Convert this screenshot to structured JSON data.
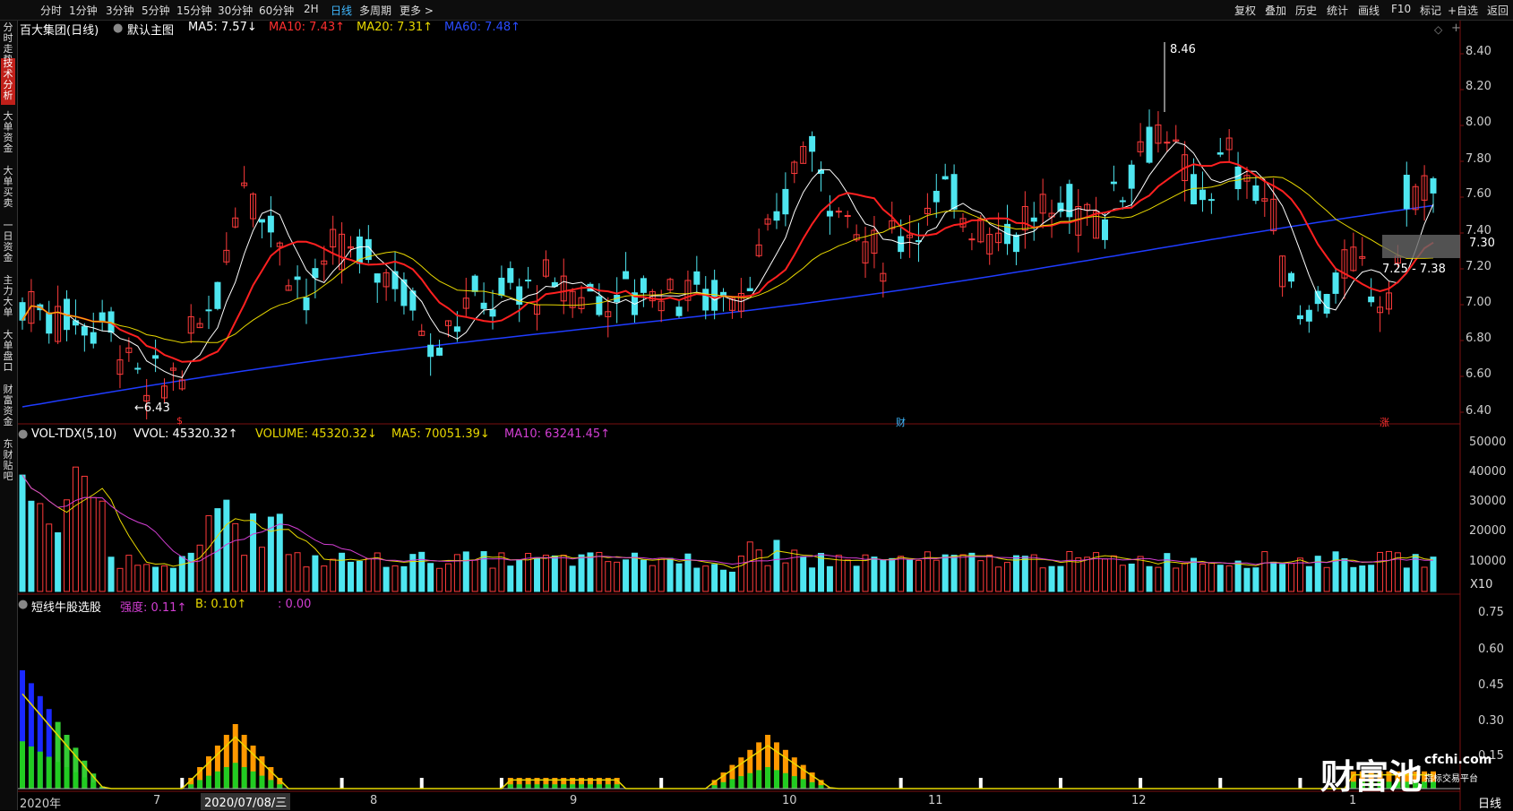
{
  "toolbar": {
    "periods": [
      "分时",
      "1分钟",
      "3分钟",
      "5分钟",
      "15分钟",
      "30分钟",
      "60分钟",
      "2H",
      "日线",
      "多周期",
      "更多 >"
    ],
    "active_period": "日线",
    "right_tools": [
      "复权",
      "叠加",
      "历史",
      "统计",
      "画线",
      "F10",
      "标记",
      "+自选",
      "返回"
    ]
  },
  "sidebar": {
    "tabs": [
      "分时走势",
      "技术分析",
      "大单资金",
      "大单买卖",
      "一日资金",
      "主力大单",
      "大单盘口",
      "财富资金",
      "东财贴吧"
    ],
    "active_tab": "技术分析"
  },
  "main_chart": {
    "stock_title": "百大集团(日线)",
    "template": "默认主图",
    "ma5": "MA5: 7.57↓",
    "ma10": "MA10: 7.43↑",
    "ma20": "MA20: 7.31↑",
    "ma60": "MA60: 7.48↑",
    "high_label": "8.46",
    "low_label": "6.43",
    "current_price": "7.30",
    "range_label": "7.25 - 7.38",
    "yticks": [
      "8.40",
      "8.20",
      "8.00",
      "7.80",
      "7.60",
      "7.40",
      "7.20",
      "7.00",
      "6.80",
      "6.60",
      "6.40"
    ],
    "markers": [
      "$",
      "财",
      "涨"
    ]
  },
  "volume_chart": {
    "indicator": "VOL-TDX(5,10)",
    "vvol": "VVOL: 45320.32↑",
    "volume": "VOLUME: 45320.32↓",
    "ma5": "MA5: 70051.39↓",
    "ma10": "MA10: 63241.45↑",
    "yticks": [
      "50000",
      "40000",
      "30000",
      "20000",
      "10000"
    ],
    "unit": "X10"
  },
  "indicator_chart": {
    "name": "短线牛股选股",
    "strength": "强度: 0.11↑",
    "b": "B: 0.10↑",
    "extra": ": 0.00",
    "yticks": [
      "0.75",
      "0.60",
      "0.45",
      "0.30",
      "0.15"
    ]
  },
  "x_axis": {
    "labels": [
      "2020年",
      "7",
      "2020/07/08/三",
      "8",
      "9",
      "10",
      "11",
      "12",
      "1"
    ],
    "period_label": "日线"
  },
  "watermark": {
    "brand": "财富池",
    "site": "cfchi.com",
    "tagline": "指标交易平台"
  },
  "colors": {
    "up": "#ff3b3b",
    "down": "#4ee6f0",
    "ma5": "#ffffff",
    "ma10": "#ff2020",
    "ma20": "#e8d800",
    "ma60": "#1f3cff",
    "volma10": "#d23ed2"
  }
}
